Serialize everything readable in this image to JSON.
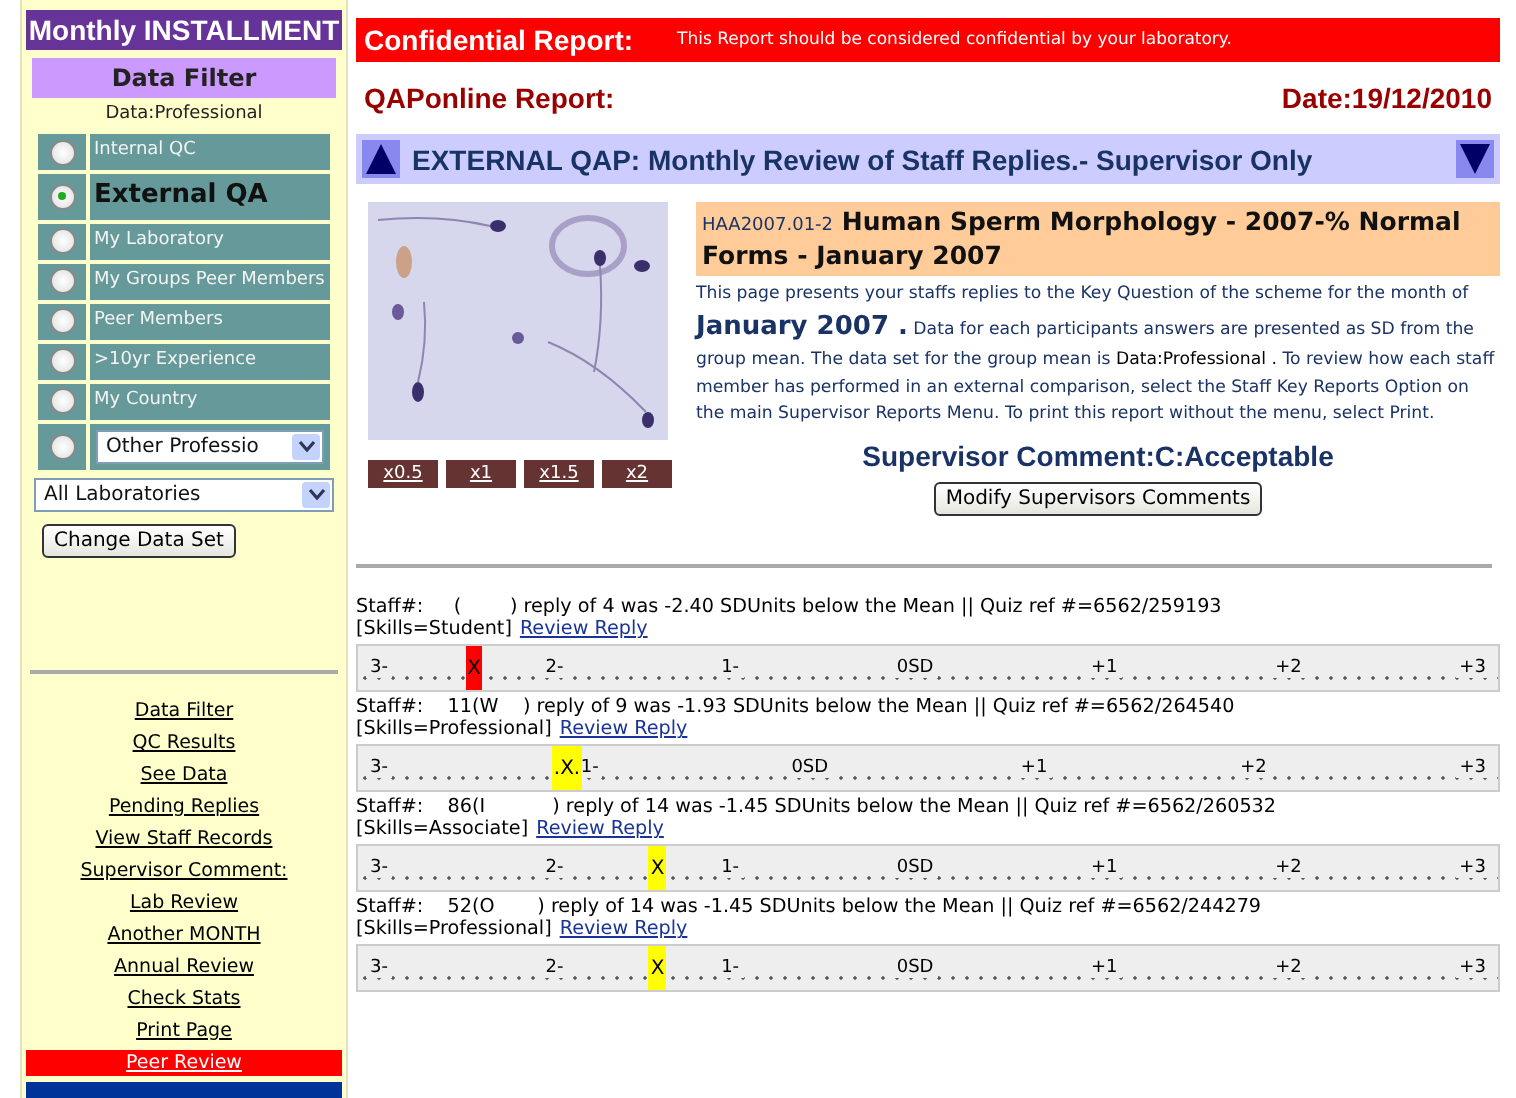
{
  "sidebar": {
    "title": "Monthly INSTALLMENT",
    "filter_title": "Data Filter",
    "data_label": "Data:Professional",
    "options": [
      {
        "kind": "radio",
        "label": "Internal QC",
        "selected": false
      },
      {
        "kind": "radio",
        "label": "External QA",
        "selected": true
      },
      {
        "kind": "radio",
        "label": "My Laboratory",
        "selected": false
      },
      {
        "kind": "radio",
        "label": "My Groups Peer Members",
        "selected": false
      },
      {
        "kind": "radio",
        "label": "Peer Members",
        "selected": false
      },
      {
        "kind": "radio",
        "label": ">10yr Experience",
        "selected": false
      },
      {
        "kind": "radio",
        "label": "My Country",
        "selected": false
      },
      {
        "kind": "select",
        "label": "Other Professio",
        "selected": false
      }
    ],
    "lab_select": "All Laboratories",
    "change_button": "Change Data Set",
    "links": [
      {
        "label": "Data Filter",
        "selected": false
      },
      {
        "label": "QC Results",
        "selected": false
      },
      {
        "label": "See Data",
        "selected": false
      },
      {
        "label": "Pending Replies",
        "selected": false
      },
      {
        "label": "View Staff Records",
        "selected": false
      },
      {
        "label": "Supervisor Comment:",
        "selected": false
      },
      {
        "label": "Lab Review",
        "selected": false
      },
      {
        "label": "Another MONTH",
        "selected": false
      },
      {
        "label": "Annual Review",
        "selected": false
      },
      {
        "label": "Check Stats",
        "selected": false
      },
      {
        "label": "Print Page",
        "selected": false
      },
      {
        "label": "Peer Review",
        "selected": true
      }
    ]
  },
  "confidential": {
    "title": "Confidential Report:",
    "message": "This Report should be considered confidential by your laboratory."
  },
  "report_title": "QAPonline Report:",
  "date": "Date:19/12/2010",
  "section_title": "EXTERNAL QAP: Monthly Review of Staff Replies.- Supervisor Only",
  "zoom_buttons": [
    "x0.5",
    "x1",
    "x1.5",
    "x2"
  ],
  "test": {
    "code": "HAA2007.01-2",
    "title": "Human Sperm Morphology - 2007-% Normal Forms - January 2007"
  },
  "description": [
    {
      "kind": "normal",
      "text": "This page presents your staffs replies to the Key Question of the scheme for the month of "
    },
    {
      "kind": "emphasis",
      "text": "January 2007 ."
    },
    {
      "kind": "normal",
      "text": " Data for each participants answers are presented as SD from the group mean. The data set for the group mean is "
    },
    {
      "kind": "data",
      "text": "Data:Professional ."
    },
    {
      "kind": "normal",
      "text": " To review how each staff member has performed in an external comparison, select the Staff Key Reports Option on the main Supervisor Reports Menu. To print this report without the menu, select Print."
    }
  ],
  "supervisor_comment": "Supervisor Comment:C:Acceptable",
  "modify_button": "Modify Supervisors Comments",
  "replies": [
    {
      "line": "Staff#:     (        ) reply of 4 was -2.40 SDUnits below the Mean || Quiz ref #=6562/259193",
      "skills": "[Skills=Student]",
      "link": "Review Reply",
      "scale": {
        "ticks": [
          "3-",
          "2-",
          "1-",
          "0SD",
          "+1",
          "+2",
          "+3"
        ],
        "mark": "X",
        "color": "#ff0000",
        "level": 0.094
      }
    },
    {
      "line": "Staff#:    11(W    ) reply of 9 was -1.93 SDUnits below the Mean || Quiz ref #=6562/264540",
      "skills": "[Skills=Professional]",
      "link": "Review Reply",
      "scale": {
        "ticks": [
          "3-",
          "1-",
          "0SD",
          "+1",
          "+2",
          "+3"
        ],
        "mark": ".X.",
        "color": "#ffff00",
        "level": 0.17
      }
    },
    {
      "line": "Staff#:    86(I           ) reply of 14 was -1.45 SDUnits below the Mean || Quiz ref #=6562/260532",
      "skills": "[Skills=Associate]",
      "link": "Review Reply",
      "scale": {
        "ticks": [
          "3-",
          "2-",
          "1-",
          "0SD",
          "+1",
          "+2",
          "+3"
        ],
        "mark": "X",
        "color": "#ffff00",
        "level": 0.255
      }
    },
    {
      "line": "Staff#:    52(O       ) reply of 14 was -1.45 SDUnits below the Mean || Quiz ref #=6562/244279",
      "skills": "[Skills=Professional]",
      "link": "Review Reply",
      "scale": {
        "ticks": [
          "3-",
          "2-",
          "1-",
          "0SD",
          "+1",
          "+2",
          "+3"
        ],
        "mark": "X",
        "color": "#ffff00",
        "level": 0.255
      }
    }
  ]
}
